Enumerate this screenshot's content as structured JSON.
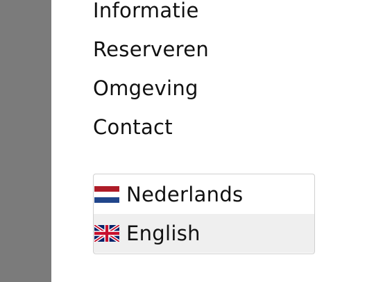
{
  "nav": {
    "items": [
      {
        "label": "Informatie"
      },
      {
        "label": "Reserveren"
      },
      {
        "label": "Omgeving"
      },
      {
        "label": "Contact"
      }
    ]
  },
  "language_selector": {
    "options": [
      {
        "label": "Nederlands",
        "flag": "flag-nl-icon",
        "selected": false
      },
      {
        "label": "English",
        "flag": "flag-gb-icon",
        "selected": true
      }
    ]
  },
  "colors": {
    "overlay": "#7b7b7b",
    "selected_background": "#efefef",
    "border": "#cfcfcf",
    "text": "#111111"
  }
}
